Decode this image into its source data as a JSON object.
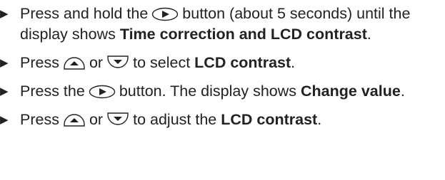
{
  "bullet_glyph": "▶",
  "items": [
    {
      "t1": "Press and hold the",
      "t2": "button (about 5 seconds) until the display shows",
      "b1": "Time correction and LCD contrast",
      "t3": "."
    },
    {
      "t1": "Press",
      "t2": "or",
      "t3": "to select",
      "b1": "LCD contrast",
      "t4": "."
    },
    {
      "t1": "Press the",
      "t2": "button. The display shows",
      "b1": "Change value",
      "t3": "."
    },
    {
      "t1": "Press",
      "t2": "or",
      "t3": "to adjust the",
      "b1": "LCD contrast",
      "t4": "."
    }
  ],
  "icons": {
    "right": "right-arrow-button-icon",
    "up": "up-arrow-button-icon",
    "down": "down-arrow-button-icon"
  },
  "colors": {
    "text": "#222222"
  }
}
